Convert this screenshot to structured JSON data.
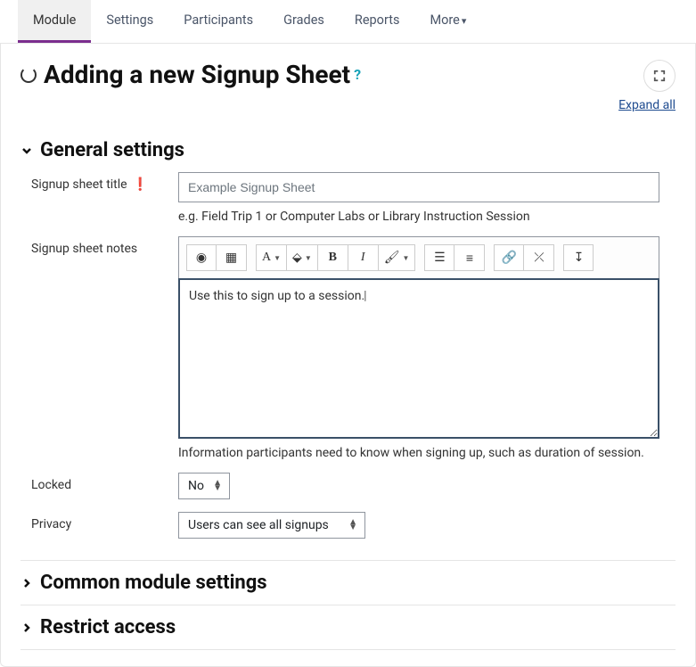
{
  "tabs": {
    "items": [
      {
        "label": "Module",
        "name": "tab-module",
        "active": true
      },
      {
        "label": "Settings",
        "name": "tab-settings"
      },
      {
        "label": "Participants",
        "name": "tab-participants"
      },
      {
        "label": "Grades",
        "name": "tab-grades"
      },
      {
        "label": "Reports",
        "name": "tab-reports"
      },
      {
        "label": "More",
        "name": "tab-more",
        "dropdown": true
      }
    ]
  },
  "heading": {
    "title": "Adding a new Signup Sheet",
    "expand_all": "Expand all"
  },
  "sections": {
    "general": {
      "title": "General settings",
      "fields": {
        "title": {
          "label": "Signup sheet title",
          "value": "Example Signup Sheet",
          "help": "e.g. Field Trip 1 or Computer Labs or Library Instruction Session"
        },
        "notes": {
          "label": "Signup sheet notes",
          "value": "Use this to sign up to a session.",
          "help": "Information participants need to know when signing up, such as duration of session."
        },
        "locked": {
          "label": "Locked",
          "value": "No"
        },
        "privacy": {
          "label": "Privacy",
          "value": "Users can see all signups"
        }
      }
    },
    "common": {
      "title": "Common module settings"
    },
    "restrict": {
      "title": "Restrict access"
    }
  },
  "editor": {
    "buttons": {
      "a11y": "Accessibility",
      "layout": "Layout",
      "font": "A",
      "fg": "Foreground",
      "bold": "B",
      "italic": "I",
      "brush": "Brush",
      "ul": "Bullets",
      "ol": "Numbered",
      "link": "Link",
      "unlink": "Unlink",
      "expand": "Expand"
    }
  }
}
